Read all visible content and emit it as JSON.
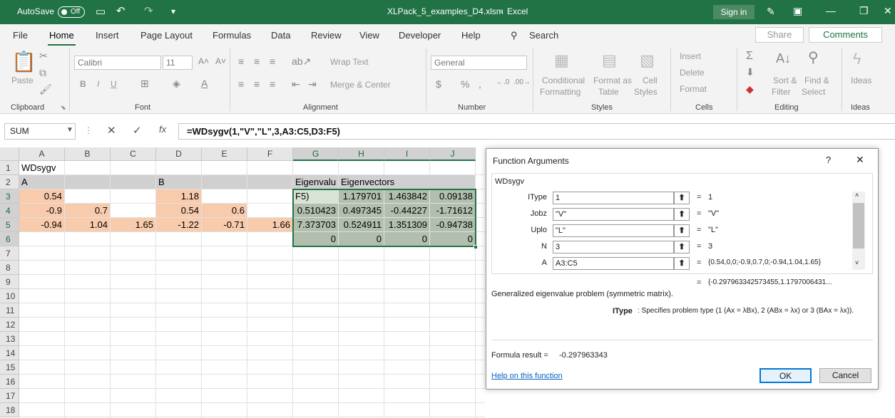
{
  "titlebar": {
    "autosave": "AutoSave",
    "toggle": "Off",
    "filename": "XLPack_5_examples_D4.xlsm",
    "app": "Excel",
    "separator": "-",
    "signin": "Sign in"
  },
  "menu": {
    "items": [
      "File",
      "Home",
      "Insert",
      "Page Layout",
      "Formulas",
      "Data",
      "Review",
      "View",
      "Developer",
      "Help"
    ],
    "active": "Home",
    "search": "Search",
    "share": "Share",
    "comments": "Comments"
  },
  "ribbon": {
    "clipboard": {
      "paste": "Paste",
      "label": "Clipboard"
    },
    "font": {
      "name": "Calibri",
      "size": "11",
      "label": "Font",
      "bold": "B",
      "italic": "I",
      "underline": "U"
    },
    "alignment": {
      "wrap": "Wrap Text",
      "merge": "Merge & Center",
      "label": "Alignment"
    },
    "number": {
      "format": "General",
      "label": "Number"
    },
    "styles": {
      "conditional1": "Conditional",
      "conditional2": "Formatting",
      "formatas1": "Format as",
      "formatas2": "Table",
      "cell1": "Cell",
      "cell2": "Styles",
      "label": "Styles"
    },
    "cells": {
      "insert": "Insert",
      "delete": "Delete",
      "format": "Format",
      "label": "Cells"
    },
    "editing": {
      "sort1": "Sort &",
      "sort2": "Filter",
      "find1": "Find &",
      "find2": "Select",
      "label": "Editing"
    },
    "ideas": {
      "ideas": "Ideas",
      "label": "Ideas"
    }
  },
  "formulabar": {
    "namebox": "SUM",
    "formula": "=WDsygv(1,\"V\",\"L\",3,A3:C5,D3:F5)"
  },
  "sheet": {
    "columns": [
      "A",
      "B",
      "C",
      "D",
      "E",
      "F",
      "G",
      "H",
      "I",
      "J"
    ],
    "rows": [
      "1",
      "2",
      "3",
      "4",
      "5",
      "6",
      "7",
      "8",
      "9",
      "10",
      "11",
      "12",
      "13",
      "14",
      "15",
      "16",
      "17",
      "18"
    ],
    "r1": {
      "a": "WDsygv"
    },
    "r2": {
      "a": "A",
      "d": "B",
      "g": "Eigenvalu",
      "h": "Eigenvectors"
    },
    "r3": {
      "a": "0.54",
      "d": "1.18",
      "g": "F5)",
      "h": "1.179701",
      "i": "1.463842",
      "j": "0.09138"
    },
    "r4": {
      "a": "-0.9",
      "b": "0.7",
      "d": "0.54",
      "e": "0.6",
      "g": "0.510423",
      "h": "0.497345",
      "i": "-0.44227",
      "j": "-1.71612"
    },
    "r5": {
      "a": "-0.94",
      "b": "1.04",
      "c": "1.65",
      "d": "-1.22",
      "e": "-0.71",
      "f": "1.66",
      "g": "7.373703",
      "h": "0.524911",
      "i": "1.351309",
      "j": "-0.94738"
    },
    "r6": {
      "g": "0",
      "h": "0",
      "i": "0",
      "j": "0"
    }
  },
  "dialog": {
    "title": "Function Arguments",
    "help_mark": "?",
    "close": "✕",
    "fname": "WDsygv",
    "args": [
      {
        "label": "IType",
        "value": "1",
        "result": "1"
      },
      {
        "label": "Jobz",
        "value": "\"V\"",
        "result": "\"V\""
      },
      {
        "label": "Uplo",
        "value": "\"L\"",
        "result": "\"L\""
      },
      {
        "label": "N",
        "value": "3",
        "result": "3"
      },
      {
        "label": "A",
        "value": "A3:C5",
        "result": "{0.54,0,0;-0.9,0.7,0;-0.94,1.04,1.65}"
      }
    ],
    "eq": "=",
    "overall": "{-0.297963342573455,1.1797006431...",
    "description": "Generalized eigenvalue problem (symmetric matrix).",
    "argname": "IType",
    "argdesc": ": Specifies problem type (1 (Ax = λBx), 2 (ABx = λx) or 3 (BAx = λx)).",
    "result_label": "Formula result =",
    "result_value": "-0.297963343",
    "help_link": "Help on this function",
    "ok": "OK",
    "cancel": "Cancel"
  },
  "colors": {
    "excel_green": "#217346",
    "peach": "#f8cbad",
    "header_grey": "#d0d0d0",
    "selection": "#b2bfae"
  }
}
